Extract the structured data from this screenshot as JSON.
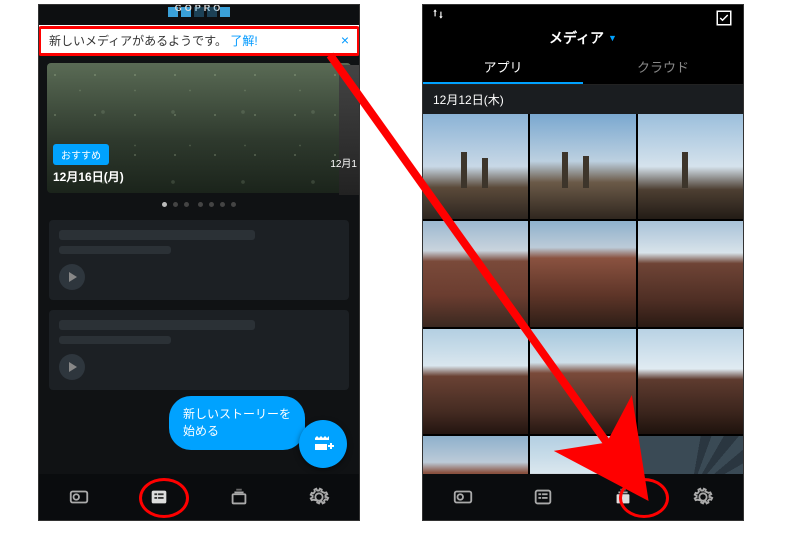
{
  "left": {
    "logo_text": "GOPRO",
    "banner": {
      "message": "新しいメディアがあるようです。",
      "link": "了解!",
      "close": "×"
    },
    "hero": {
      "badge": "おすすめ",
      "date": "12月16日(月)"
    },
    "peek": {
      "date": "12月1"
    },
    "fab_bubble": "新しいストーリーを\n始める"
  },
  "right": {
    "title": "メディア",
    "tabs": {
      "app": "アプリ",
      "cloud": "クラウド"
    },
    "date_header": "12月12日(木)"
  }
}
